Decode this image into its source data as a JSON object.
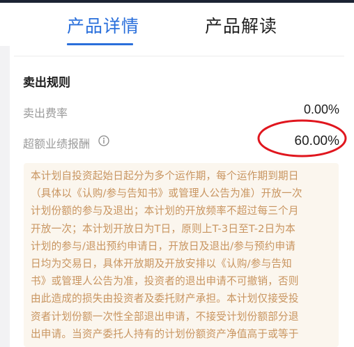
{
  "tabs": [
    {
      "label": "产品详情",
      "active": true
    },
    {
      "label": "产品解读",
      "active": false
    }
  ],
  "section": {
    "title": "卖出规则",
    "rows": [
      {
        "label": "卖出费率",
        "value": "0.00%"
      },
      {
        "label": "超额业绩报酬",
        "value": "60.00%",
        "icon": "info-icon"
      }
    ]
  },
  "notice_lines": [
    "本计划自投资起始日起分为多个运作期，每个运作期到期日",
    "（具体以《认购/参与告知书》或管理人公告为准）开放一次",
    "计划份额的参与及退出；本计划的开放频率不超过每三个月",
    "开放一次；本计划开放日为T日，原则上T-3日至T-2日为本",
    "计划的参与/退出预约申请日，开放日及退出/参与预约申请",
    "日均为交易日，具体开放期及开放安排以《认购/参与告知",
    "书》或管理人公告为准，投资者的退出申请不可撤销，否则",
    "由此造成的损失由投资者及委托财产承担。本计划仅接受投",
    "资者计划份额一次性全部退出申请，不接受计划份额部分退",
    "出申请。当资产委托人持有的计划份额资产净值高于或等于"
  ],
  "colors": {
    "accent": "#2a6fdb",
    "annotation": "#e0161e",
    "notice_text": "#c8945f",
    "notice_bg": "#fbf6ee"
  }
}
